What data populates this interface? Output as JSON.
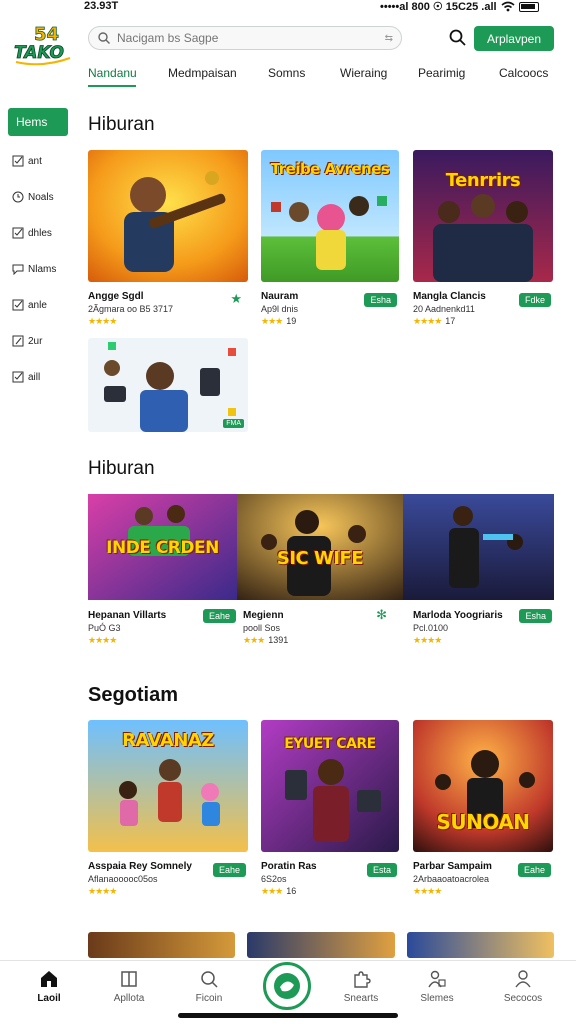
{
  "status_bar": {
    "time": "23.93T",
    "right_text": "•••••al 800 ☉ 15C25 .all"
  },
  "header": {
    "logo_text": "54 TAKO",
    "search_placeholder": "Nacigam bs Sagpe",
    "apply_button": "Arplavpen"
  },
  "tabs": [
    {
      "label": "Nandanu",
      "active": true
    },
    {
      "label": "Medmpaisan",
      "active": false
    },
    {
      "label": "Somns",
      "active": false
    },
    {
      "label": "Wieraing",
      "active": false
    },
    {
      "label": "Pearimig",
      "active": false
    },
    {
      "label": "Calcoocs",
      "active": false
    }
  ],
  "sidebar": {
    "active_label": "Hems",
    "items": [
      "ant",
      "Noals",
      "dhles",
      "Nlams",
      "anle",
      "2ur",
      "aill"
    ]
  },
  "section1": {
    "title": "Hiburan",
    "cards": [
      {
        "name": "Angge Sgdl",
        "sub": "2Ãgmara oo B5 3717",
        "stars": "★★★★",
        "rating": "",
        "action_icon": "★",
        "thumb_title": ""
      },
      {
        "name": "Nauram",
        "sub": "Ap9l dnis",
        "stars": "★★★",
        "rating": "19",
        "action": "Esha",
        "thumb_title": "Treibe Avrenes"
      },
      {
        "name": "Mangla Clancis",
        "sub": "20 Aadnenkd11",
        "stars": "★★★★",
        "rating": "17",
        "action": "Fdke",
        "thumb_title": "Tenrrirs"
      },
      {
        "name": "",
        "sub": "",
        "stars": "",
        "rating": "",
        "badge": "FMA",
        "thumb_title": ""
      }
    ]
  },
  "section2": {
    "title": "Hiburan",
    "cards": [
      {
        "name": "Hepanan Villarts",
        "sub": "PuÓ G3",
        "stars": "★★★★",
        "rating": "",
        "action": "Eahe",
        "thumb_title": "INDE CRDEN"
      },
      {
        "name": "Megienn",
        "sub": "pooll Sos",
        "stars": "★★★",
        "rating": "1391",
        "action_icon": "✻",
        "thumb_title": "SIC WIFE"
      },
      {
        "name": "Marloda Yoogriaris",
        "sub": "Pcl.0100",
        "stars": "★★★★",
        "rating": "",
        "action": "Esha",
        "thumb_title": ""
      }
    ]
  },
  "section3": {
    "title": "Segotiam",
    "cards": [
      {
        "name": "Asspaia Rey Somnely",
        "sub": "Aflanaooooc05os",
        "stars": "★★★★",
        "rating": "",
        "action": "Eahe",
        "thumb_title": "RAVANAZ"
      },
      {
        "name": "Poratin Ras",
        "sub": "6S2os",
        "stars": "★★★",
        "rating": "16",
        "action": "Esta",
        "thumb_title": "EYUET CARE"
      },
      {
        "name": "Parbar Sampaim",
        "sub": "2Arbaaoatoacrolea",
        "stars": "★★★★",
        "rating": "",
        "action": "Eahe",
        "thumb_title": "SUNOAN"
      }
    ]
  },
  "bottom_nav": [
    {
      "label": "Laoil",
      "icon": "home-icon",
      "active": true
    },
    {
      "label": "Apllota",
      "icon": "grid-icon",
      "active": false
    },
    {
      "label": "Ficoin",
      "icon": "search-icon",
      "active": false
    },
    {
      "label": "",
      "icon": "center-logo-icon",
      "active": false
    },
    {
      "label": "Snearts",
      "icon": "puzzle-icon",
      "active": false
    },
    {
      "label": "Slemes",
      "icon": "person-badge-icon",
      "active": false
    },
    {
      "label": "Secocos",
      "icon": "user-icon",
      "active": false
    }
  ],
  "colors": {
    "accent": "#1d9a55",
    "star": "#f5b400"
  }
}
